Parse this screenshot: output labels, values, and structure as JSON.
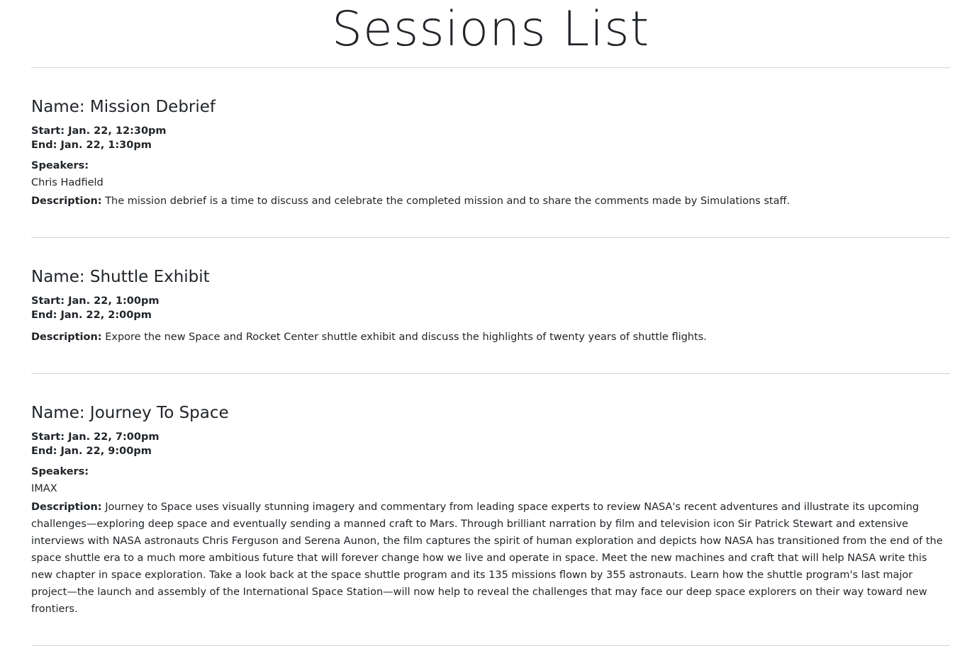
{
  "page": {
    "title": "Sessions List"
  },
  "labels": {
    "name": "Name: ",
    "start": "Start: ",
    "end": "End: ",
    "speakers": "Speakers:",
    "description": "Description:"
  },
  "sessions": [
    {
      "name": "Mission Debrief",
      "start": "Jan. 22, 12:30pm",
      "end": "Jan. 22, 1:30pm",
      "speakers": "Chris Hadfield",
      "description": "The mission debrief is a time to discuss and celebrate the completed mission and to share the comments made by Simulations staff."
    },
    {
      "name": "Shuttle Exhibit",
      "start": "Jan. 22, 1:00pm",
      "end": "Jan. 22, 2:00pm",
      "description": "Expore the new Space and Rocket Center shuttle exhibit and discuss the highlights of twenty years of shuttle flights."
    },
    {
      "name": "Journey To Space",
      "start": "Jan. 22, 7:00pm",
      "end": "Jan. 22, 9:00pm",
      "speakers": "IMAX",
      "description": "Journey to Space uses visually stunning imagery and commentary from leading space experts to review NASA's recent adventures and illustrate its upcoming challenges—exploring deep space and eventually sending a manned craft to Mars. Through brilliant narration by film and television icon Sir Patrick Stewart and extensive interviews with NASA astronauts Chris Ferguson and Serena Aunon, the film captures the spirit of human exploration and depicts how NASA has transitioned from the end of the space shuttle era to a much more ambitious future that will forever change how we live and operate in space. Meet the new machines and craft that will help NASA write this new chapter in space exploration. Take a look back at the space shuttle program and its 135 missions flown by 355 astronauts. Learn how the shuttle program's last major project—the launch and assembly of the International Space Station—will now help to reveal the challenges that may face our deep space explorers on their way toward new frontiers."
    }
  ]
}
